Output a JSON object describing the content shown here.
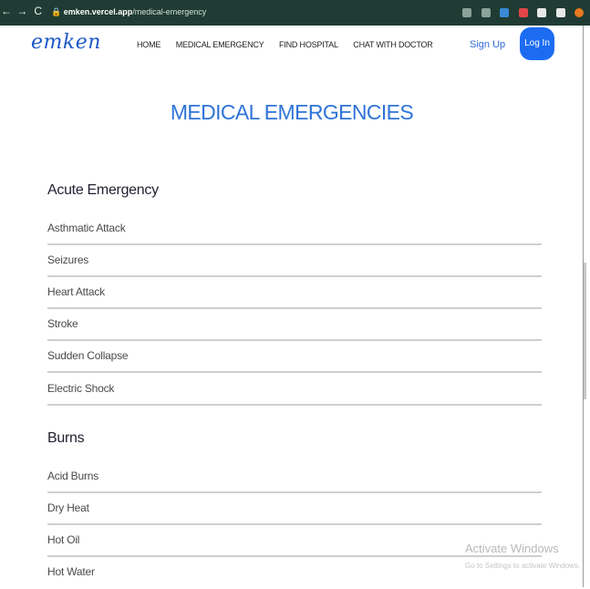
{
  "browser": {
    "nav_back": "←",
    "nav_forward": "→",
    "nav_reload": "C",
    "url_host": "emken.vercel.app",
    "url_path": "/medical-emergency"
  },
  "header": {
    "logo": "emken",
    "menu": [
      "HOME",
      "MEDICAL EMERGENCY",
      "FIND HOSPITAL",
      "CHAT WITH DOCTOR"
    ],
    "signup": "Sign Up",
    "login": "Log In"
  },
  "page_title": "MEDICAL EMERGENCIES",
  "sections": [
    {
      "title": "Acute Emergency",
      "items": [
        "Asthmatic Attack",
        "Seizures",
        "Heart Attack",
        "Stroke",
        "Sudden Collapse",
        "Electric Shock"
      ]
    },
    {
      "title": "Burns",
      "items": [
        "Acid Burns",
        "Dry Heat",
        "Hot Oil",
        "Hot Water"
      ]
    }
  ],
  "watermark": {
    "title": "Activate Windows",
    "subtitle": "Go to Settings to activate Windows."
  },
  "colors": {
    "accent": "#2f73d8",
    "login_button": "#1c6cf2",
    "chrome_bar": "#1f3b33"
  }
}
